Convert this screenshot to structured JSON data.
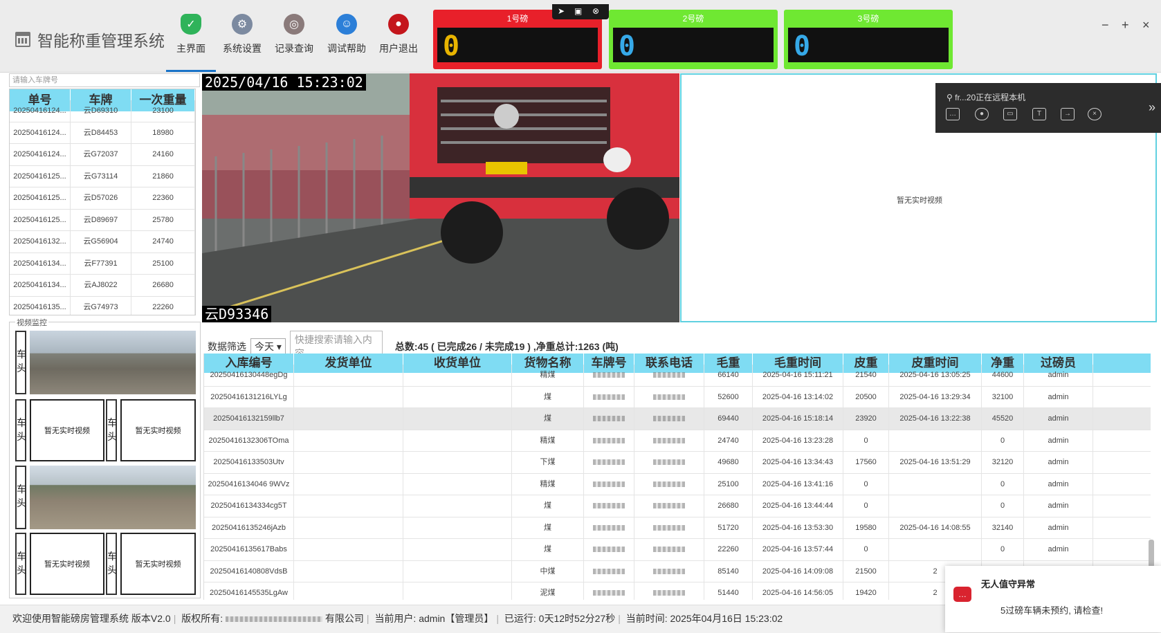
{
  "app": {
    "title": "智能称重管理系统"
  },
  "nav": [
    {
      "label": "主界面",
      "icon": "shield-check-icon",
      "color": "#2fb35a"
    },
    {
      "label": "系统设置",
      "icon": "gear-icon",
      "color": "#7c8aa0"
    },
    {
      "label": "记录查询",
      "icon": "magnifier-icon",
      "color": "#8a7a7a"
    },
    {
      "label": "调试帮助",
      "icon": "accessibility-icon",
      "color": "#2c7fd8"
    },
    {
      "label": "用户退出",
      "icon": "power-icon",
      "color": "#c4161c"
    }
  ],
  "scales": [
    {
      "label": "1号磅",
      "value": "0",
      "header_color": "#e8202a",
      "digit_color": "#e8b400"
    },
    {
      "label": "2号磅",
      "value": "0",
      "header_color": "#6fe832",
      "digit_color": "#36a9e8"
    },
    {
      "label": "3号磅",
      "value": "0",
      "header_color": "#6fe832",
      "digit_color": "#36a9e8"
    }
  ],
  "window_controls": {
    "minimize": "−",
    "maximize": "+",
    "close": "×"
  },
  "left_panel": {
    "search_placeholder": "请输入车牌号",
    "columns": [
      "单号",
      "车牌",
      "一次重量"
    ],
    "rows": [
      [
        "20250416124...",
        "云D69310",
        "23100"
      ],
      [
        "20250416124...",
        "云D84453",
        "18980"
      ],
      [
        "20250416124...",
        "云G72037",
        "24160"
      ],
      [
        "20250416125...",
        "云G73114",
        "21860"
      ],
      [
        "20250416125...",
        "云D57026",
        "22360"
      ],
      [
        "20250416125...",
        "云D89697",
        "25780"
      ],
      [
        "20250416132...",
        "云G56904",
        "24740"
      ],
      [
        "20250416134...",
        "云F77391",
        "25100"
      ],
      [
        "20250416134...",
        "云AJ8022",
        "26680"
      ],
      [
        "20250416135...",
        "云G74973",
        "22260"
      ]
    ]
  },
  "monitor": {
    "label": "视频监控",
    "side_label": "车头",
    "no_video": "暂无实时视频"
  },
  "camera": {
    "timestamp": "2025/04/16 15:23:02",
    "plate": "云D93346",
    "second_no_video": "暂无实时视频"
  },
  "remote": {
    "title": "fr...20正在远程本机",
    "icons": [
      "chat-icon",
      "microphone-icon",
      "screen-icon",
      "text-icon",
      "folder-icon",
      "close-circle-icon"
    ],
    "expand": "»"
  },
  "filter": {
    "label": "数据筛选",
    "range": "今天",
    "search_placeholder": "快捷搜索请输入内容",
    "summary": "总数:45 ( 已完成26 / 未完成19 ) ,净重总计:1263 (吨)"
  },
  "table": {
    "columns": [
      "入库编号",
      "发货单位",
      "收货单位",
      "货物名称",
      "车牌号",
      "联系电话",
      "毛重",
      "毛重时间",
      "皮重",
      "皮重时间",
      "净重",
      "过磅员"
    ],
    "rows": [
      [
        "20250416130448egDg",
        "",
        "",
        "精煤",
        "",
        "",
        "66140",
        "2025-04-16 15:11:21",
        "21540",
        "2025-04-16 13:05:25",
        "44600",
        "admin"
      ],
      [
        "20250416131216LYLg",
        "",
        "",
        "煤",
        "",
        "",
        "52600",
        "2025-04-16 13:14:02",
        "20500",
        "2025-04-16 13:29:34",
        "32100",
        "admin"
      ],
      [
        "20250416132159llb7",
        "",
        "",
        "煤",
        "",
        "",
        "69440",
        "2025-04-16 15:18:14",
        "23920",
        "2025-04-16 13:22:38",
        "45520",
        "admin"
      ],
      [
        "20250416132306TOma",
        "",
        "",
        "精煤",
        "",
        "",
        "24740",
        "2025-04-16 13:23:28",
        "0",
        "",
        "0",
        "admin"
      ],
      [
        "20250416133503Utv",
        "",
        "",
        "下煤",
        "",
        "",
        "49680",
        "2025-04-16 13:34:43",
        "17560",
        "2025-04-16 13:51:29",
        "32120",
        "admin"
      ],
      [
        "20250416134046 9WVz",
        "",
        "",
        "精煤",
        "",
        "",
        "25100",
        "2025-04-16 13:41:16",
        "0",
        "",
        "0",
        "admin"
      ],
      [
        "20250416134334cg5T",
        "",
        "",
        "煤",
        "",
        "",
        "26680",
        "2025-04-16 13:44:44",
        "0",
        "",
        "0",
        "admin"
      ],
      [
        "20250416135246jAzb",
        "",
        "",
        "煤",
        "",
        "",
        "51720",
        "2025-04-16 13:53:30",
        "19580",
        "2025-04-16 14:08:55",
        "32140",
        "admin"
      ],
      [
        "20250416135617Babs",
        "",
        "",
        "煤",
        "",
        "",
        "22260",
        "2025-04-16 13:57:44",
        "0",
        "",
        "0",
        "admin"
      ],
      [
        "20250416140808VdsB",
        "",
        "",
        "中煤",
        "",
        "",
        "85140",
        "2025-04-16 14:09:08",
        "21500",
        "2",
        "",
        ""
      ],
      [
        "20250416145535LgAw",
        "",
        "",
        "泥煤",
        "",
        "",
        "51440",
        "2025-04-16 14:56:05",
        "19420",
        "2",
        "",
        ""
      ]
    ]
  },
  "status": {
    "welcome": "欢迎使用智能磅房管理系统 版本V2.0",
    "copyright": "版权所有:",
    "company_suffix": "有限公司",
    "user": "当前用户: admin【管理员】",
    "uptime": "已运行: 0天12时52分27秒",
    "time": "当前时间: 2025年04月16日 15:23:02"
  },
  "alert": {
    "title": "无人值守异常",
    "message": "5过磅车辆未预约, 请检查!"
  }
}
